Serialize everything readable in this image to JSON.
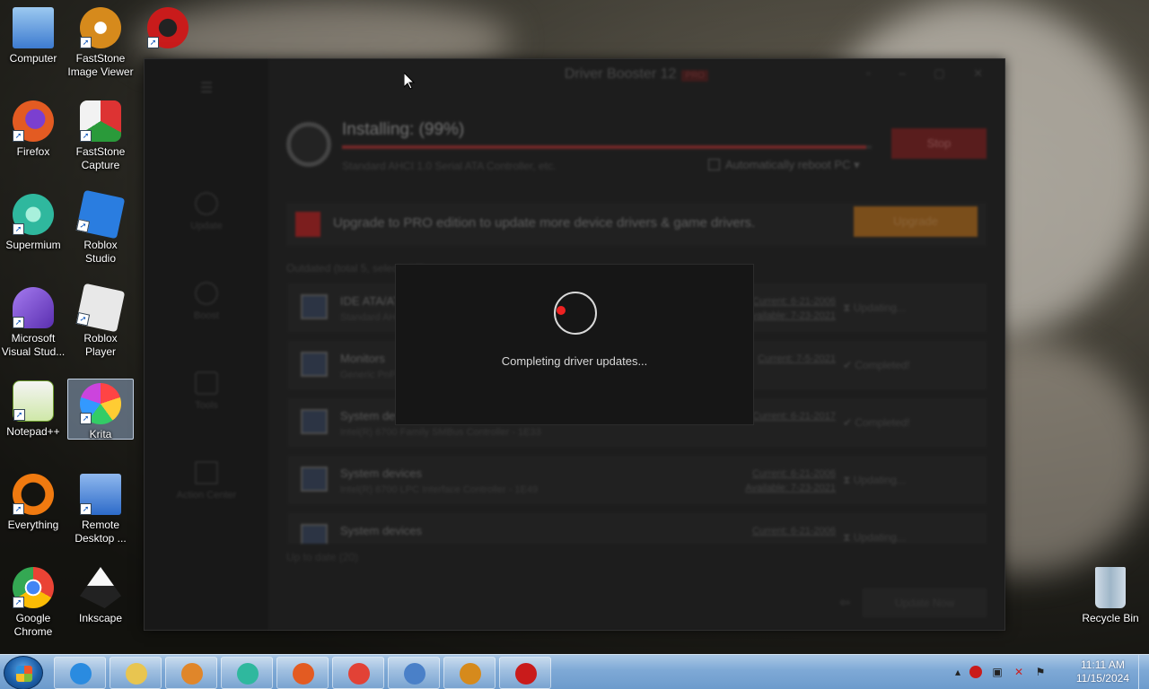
{
  "desktop": {
    "icons": [
      {
        "label": "Computer",
        "icon": "computer-icon",
        "color": "#3d7bd0"
      },
      {
        "label": "FastStone Image Viewer",
        "icon": "faststone-viewer-icon",
        "color": "#d68a1c"
      },
      {
        "label": "Firefox",
        "icon": "firefox-icon",
        "color": "#e35b22"
      },
      {
        "label": "FastStone Capture",
        "icon": "faststone-capture-icon",
        "color": "#2a9a3a"
      },
      {
        "label": "Supermium",
        "icon": "supermium-icon",
        "color": "#2fb89e"
      },
      {
        "label": "Roblox Studio",
        "icon": "roblox-studio-icon",
        "color": "#2a7de0"
      },
      {
        "label": "Microsoft Visual Stud...",
        "icon": "visual-studio-icon",
        "color": "#7a4bd0"
      },
      {
        "label": "Roblox Player",
        "icon": "roblox-player-icon",
        "color": "#e8e8e8"
      },
      {
        "label": "Notepad++",
        "icon": "notepadpp-icon",
        "color": "#7dbb3a"
      },
      {
        "label": "Krita",
        "icon": "krita-icon",
        "color": "#c24bd6"
      },
      {
        "label": "Everything",
        "icon": "everything-icon",
        "color": "#f07a10"
      },
      {
        "label": "Remote Desktop ...",
        "icon": "remote-desktop-icon",
        "color": "#2d6bc9"
      },
      {
        "label": "Google Chrome",
        "icon": "chrome-icon",
        "color": "#e24236"
      },
      {
        "label": "Inkscape",
        "icon": "inkscape-icon",
        "color": "#222222"
      },
      {
        "label": "Driver Booster",
        "icon": "driver-booster-icon",
        "color": "#c91b1b"
      },
      {
        "label": "Recycle Bin",
        "icon": "recycle-bin-icon",
        "color": "#9fb6c8"
      }
    ]
  },
  "app": {
    "title": "Driver Booster 12",
    "pro_tag": "PRO",
    "sidebar": [
      "Update",
      "Boost",
      "Tools",
      "Action Center"
    ],
    "installing_title": "Installing: (99%)",
    "progress": 0.99,
    "installing_sub": "Standard AHCI 1.0 Serial ATA Controller, etc.",
    "reboot_label": "Automatically reboot PC",
    "stop_label": "Stop",
    "upgrade_text": "Upgrade to PRO edition to update more device drivers & game drivers.",
    "upgrade_label": "Upgrade",
    "outdated_label": "Outdated (total 5, selected 5)",
    "rows": [
      {
        "name": "IDE ATA/ATAPI controllers",
        "sub": "Standard AHCI 1.0 Serial ATA Controller",
        "ver1": "Current: 6-21-2006",
        "ver2": "Available: 7-23-2021",
        "status": "Updating..."
      },
      {
        "name": "Monitors",
        "sub": "Generic PnP Monitor",
        "ver1": "",
        "ver2": "Current: 7-5-2021",
        "status": "Completed!"
      },
      {
        "name": "System devices",
        "sub": "Intel(R) 6700 Family SMBus Controller - 1E33",
        "ver1": "",
        "ver2": "Current: 6-21-2017",
        "status": "Completed!"
      },
      {
        "name": "System devices",
        "sub": "Intel(R) 6700 LPC Interface Controller - 1E49",
        "ver1": "Current: 6-21-2006",
        "ver2": "Available: 7-23-2021",
        "status": "Updating..."
      },
      {
        "name": "System devices",
        "sub": "",
        "ver1": "Current: 6-21-2006",
        "ver2": "",
        "status": "Updating..."
      }
    ],
    "uptodate_label": "Up to date (20)",
    "update_now_label": "Update Now"
  },
  "dialog": {
    "message": "Completing driver updates..."
  },
  "taskbar": {
    "apps": [
      {
        "icon": "internet-explorer-icon",
        "color": "#2a8be0"
      },
      {
        "icon": "file-explorer-icon",
        "color": "#e8c550"
      },
      {
        "icon": "media-player-icon",
        "color": "#e0862a"
      },
      {
        "icon": "supermium-icon",
        "color": "#2fb89e"
      },
      {
        "icon": "firefox-icon",
        "color": "#e35b22"
      },
      {
        "icon": "chrome-icon",
        "color": "#e24236"
      },
      {
        "icon": "control-panel-icon",
        "color": "#4a80c8"
      },
      {
        "icon": "faststone-viewer-icon",
        "color": "#d68a1c"
      },
      {
        "icon": "driver-booster-icon",
        "color": "#c91b1b"
      }
    ],
    "time": "11:11 AM",
    "date": "11/15/2024"
  }
}
